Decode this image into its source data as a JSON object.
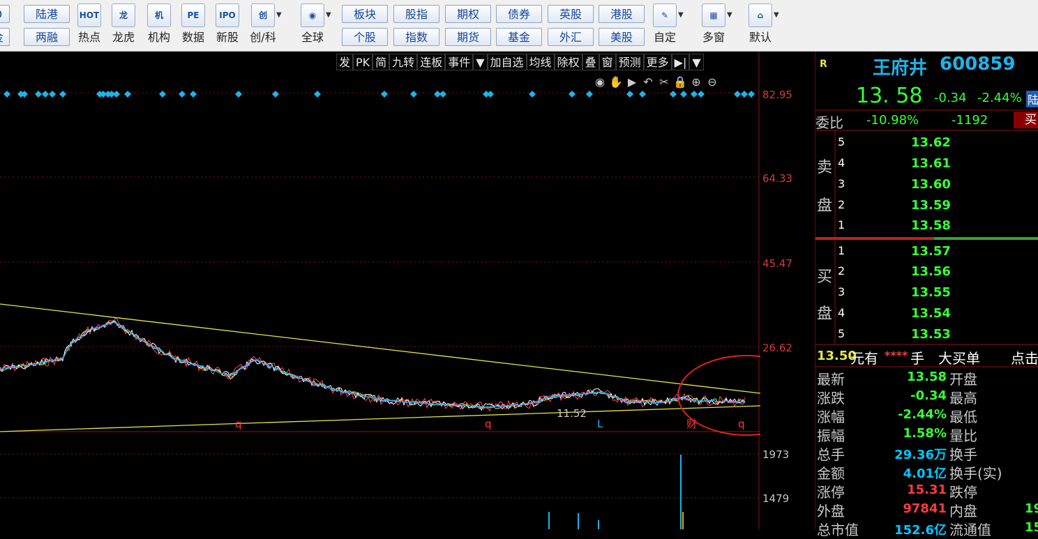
{
  "toolbar": {
    "row1": [
      "D",
      "陆港",
      "板块",
      "股指",
      "期权",
      "债券",
      "英股",
      "港股"
    ],
    "row2": [
      "金",
      "两融",
      "个股",
      "指数",
      "期货",
      "基金",
      "外汇",
      "美股"
    ],
    "icons": [
      {
        "name": "hot-icon",
        "glyph": "HOT",
        "label": "热点"
      },
      {
        "name": "dragon-tiger-icon",
        "glyph": "龙",
        "label": "龙虎"
      },
      {
        "name": "institution-icon",
        "glyph": "机",
        "label": "机构"
      },
      {
        "name": "pe-data-icon",
        "glyph": "PE",
        "label": "数据"
      },
      {
        "name": "ipo-icon",
        "glyph": "IPO",
        "label": "新股"
      },
      {
        "name": "chuang-icon",
        "glyph": "创",
        "label": "创/科"
      },
      {
        "name": "globe-icon",
        "glyph": "◉",
        "label": "全球"
      },
      {
        "name": "custom-icon",
        "glyph": "✎",
        "label": "自定"
      },
      {
        "name": "multi-window-icon",
        "glyph": "▦",
        "label": "多窗"
      },
      {
        "name": "home-icon",
        "glyph": "⌂",
        "label": "默认"
      }
    ]
  },
  "chart_toolbar": [
    "发",
    "PK",
    "简",
    "九转",
    "连板",
    "事件",
    "▼",
    "加自选",
    "均线",
    "除权",
    "叠",
    "窗",
    "预测",
    "更多",
    "▶|",
    "▼"
  ],
  "chart_tools": [
    "eye-icon",
    "hand-icon",
    "play-icon",
    "undo-icon",
    "scissors-icon",
    "lock-icon",
    "zoom-in-icon",
    "zoom-out-icon"
  ],
  "chart_tool_glyphs": [
    "◉",
    "✋",
    "▶",
    "↶",
    "✂",
    "🔒",
    "⊕",
    "⊖"
  ],
  "price_axis": [
    "82.95",
    "64.33",
    "45.47",
    "26.62"
  ],
  "volume_axis": [
    "1973",
    "1479"
  ],
  "chart_annotations": {
    "low_price": "11.52",
    "markers": [
      "q",
      "q",
      "L",
      "财",
      "q"
    ]
  },
  "colors": {
    "up": "#ff3b3b",
    "down": "#39ff39",
    "accent_yellow": "#ffff00",
    "cyan": "#00c8ff",
    "text_white": "#ffffff"
  },
  "quote": {
    "corner": "R",
    "name": "王府井",
    "code": "600859",
    "price": "13. 58",
    "change": "-0.34",
    "pct": "-2.44%",
    "tag": "陆",
    "weibi_label": "委比",
    "weibi_pct": "-10.98%",
    "weibi_diff": "-1192",
    "buy_tag": "买"
  },
  "sell_side": {
    "label1": "卖",
    "label2": "盘",
    "levels": [
      {
        "n": "5",
        "price": "13.62"
      },
      {
        "n": "4",
        "price": "13.61"
      },
      {
        "n": "3",
        "price": "13.60"
      },
      {
        "n": "2",
        "price": "13.59"
      },
      {
        "n": "1",
        "price": "13.58"
      }
    ]
  },
  "buy_side": {
    "label1": "买",
    "label2": "盘",
    "levels": [
      {
        "n": "1",
        "price": "13.57"
      },
      {
        "n": "2",
        "price": "13.56"
      },
      {
        "n": "3",
        "price": "13.55"
      },
      {
        "n": "4",
        "price": "13.54"
      },
      {
        "n": "5",
        "price": "13.53"
      }
    ]
  },
  "big_order": {
    "price": "13.50",
    "unit": "元有",
    "stars": "****",
    "shou": "手",
    "text": "大买单",
    "action": "点击"
  },
  "stats": [
    {
      "l": "最新",
      "v": "13.58",
      "r": "开盘",
      "vc": "#39ff39"
    },
    {
      "l": "涨跌",
      "v": "-0.34",
      "r": "最高",
      "vc": "#39ff39"
    },
    {
      "l": "涨幅",
      "v": "-2.44%",
      "r": "最低",
      "vc": "#39ff39"
    },
    {
      "l": "振幅",
      "v": "1.58%",
      "r": "量比",
      "vc": "#39ff39"
    },
    {
      "l": "总手",
      "v": "29.36万",
      "r": "换手",
      "vc": "#00c8ff"
    },
    {
      "l": "金额",
      "v": "4.01亿",
      "r": "换手(实)",
      "vc": "#00c8ff"
    },
    {
      "l": "涨停",
      "v": "15.31",
      "r": "跌停",
      "vc": "#ff3b3b"
    },
    {
      "l": "外盘",
      "v": "97841",
      "r": "内盘",
      "vc": "#ff3b3b"
    },
    {
      "l": "总市值",
      "v": "152.6亿",
      "r": "流通值",
      "vc": "#00c8ff"
    }
  ],
  "right_partial": [
    "",
    "",
    "",
    "",
    "",
    "",
    "",
    "19",
    "15"
  ]
}
